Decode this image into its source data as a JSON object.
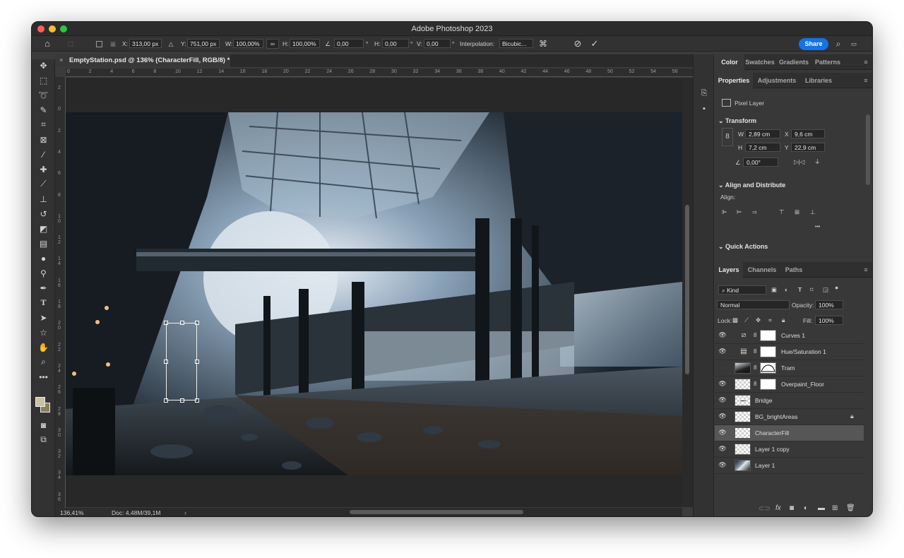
{
  "app": {
    "title": "Adobe Photoshop 2023"
  },
  "options_bar": {
    "x_label": "X:",
    "x_value": "313,00 px",
    "y_label": "Y:",
    "y_value": "751,00 px",
    "w_label": "W:",
    "w_value": "100,00%",
    "h_label": "H:",
    "h_value": "100,00%",
    "angle_value": "0,00",
    "hskew_label": "H:",
    "hskew_value": "0,00",
    "vskew_label": "V:",
    "vskew_value": "0,00",
    "deg": "°",
    "interp_label": "Interpolation:",
    "interp_value": "Bicubic...",
    "share_label": "Share"
  },
  "document": {
    "tab_title": "EmptyStation.psd @ 136% (CharacterFill, RGB/8) *",
    "close": "×",
    "zoom": "136,41%",
    "doc_info": "Doc: 4,48M/39,1M",
    "ruler_h": [
      "0",
      "2",
      "4",
      "6",
      "8",
      "10",
      "12",
      "14",
      "16",
      "18",
      "20",
      "22",
      "24",
      "26",
      "28",
      "30",
      "32",
      "34",
      "36",
      "38",
      "40",
      "42",
      "44",
      "46",
      "48",
      "50",
      "52",
      "54",
      "56"
    ],
    "ruler_v": [
      "2",
      "0",
      "2",
      "4",
      "6",
      "8",
      "1\n0",
      "1\n2",
      "1\n4",
      "1\n6",
      "1\n8",
      "2\n0",
      "2\n2",
      "2\n4",
      "2\n6",
      "2\n8",
      "3\n0",
      "3\n2",
      "3\n4",
      "3\n6"
    ]
  },
  "panels": {
    "top_tabs": [
      "Color",
      "Swatches",
      "Gradients",
      "Patterns"
    ],
    "props_tabs": [
      "Properties",
      "Adjustments",
      "Libraries"
    ],
    "pixel_layer": "Pixel Layer",
    "transform": {
      "title": "Transform",
      "w_label": "W",
      "w": "2,89 cm",
      "x_label": "X",
      "x": "9,6 cm",
      "h_label": "H",
      "h": "7,2 cm",
      "y_label": "Y",
      "y": "22,9 cm",
      "angle": "0,00°"
    },
    "align": {
      "title": "Align and Distribute",
      "align_label": "Align:",
      "more": "•••"
    },
    "quick_actions": {
      "title": "Quick Actions"
    },
    "layers_tabs": [
      "Layers",
      "Channels",
      "Paths"
    ],
    "filter_kind": "Kind",
    "blend_mode": "Normal",
    "opacity_label": "Opacity:",
    "opacity": "100%",
    "lock_label": "Lock:",
    "fill_label": "Fill:",
    "fill": "100%",
    "layers": [
      {
        "name": "Curves 1",
        "visible": true
      },
      {
        "name": "Hue/Saturation 1",
        "visible": true
      },
      {
        "name": "Tram",
        "visible": false
      },
      {
        "name": "Overpaint_Floor",
        "visible": true
      },
      {
        "name": "Bridge",
        "visible": true
      },
      {
        "name": "BG_brightAreas",
        "visible": true
      },
      {
        "name": "CharacterFill",
        "visible": true,
        "selected": true
      },
      {
        "name": "Layer 1 copy",
        "visible": true
      },
      {
        "name": "Layer 1",
        "visible": true
      }
    ]
  },
  "colors": {
    "accent": "#1473e6",
    "selected_row": "#565656"
  }
}
